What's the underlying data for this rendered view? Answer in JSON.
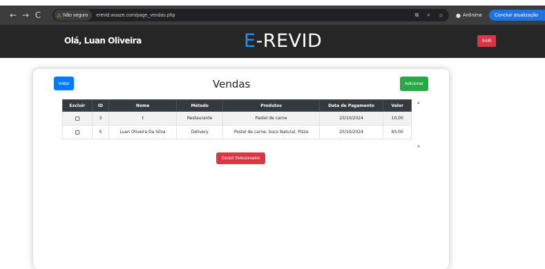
{
  "browser": {
    "back_icon": "←",
    "forward_icon": "→",
    "reload_icon": "C",
    "security_label": "Não seguro",
    "url": "erevid.wuaze.com/page_vendas.php",
    "incognito_label": "Anônima",
    "update_label": "Concluir atualização"
  },
  "header": {
    "greeting": "Olá, Luan Oliveira",
    "logo_prefix": "E",
    "logo_suffix": "-REVID",
    "logout_label": "SAIR",
    "accent_color": "#1e90ff"
  },
  "page": {
    "back_label": "Voltar",
    "title": "Vendas",
    "add_label": "Adicionar",
    "delete_selected_label": "Excluir Selecionados"
  },
  "table": {
    "columns": [
      "Excluir",
      "ID",
      "Nome",
      "Método",
      "Produtos",
      "Data de Pagamento",
      "Valor"
    ],
    "rows": [
      {
        "id": "3",
        "nome": "t",
        "metodo": "Restaurante",
        "produtos": "Pastel de carne",
        "data": "23/10/2024",
        "valor": "10,00"
      },
      {
        "id": "5",
        "nome": "Luan Oliveira Da Silva",
        "metodo": "Delivery",
        "produtos": "Pastel de carne, Suco Natural, Pizza",
        "data": "25/10/2024",
        "valor": "65,00"
      }
    ]
  },
  "colors": {
    "primary": "#007bff",
    "success": "#28a745",
    "danger": "#dc3545",
    "header_bg": "#262626",
    "table_head": "#343a40"
  }
}
